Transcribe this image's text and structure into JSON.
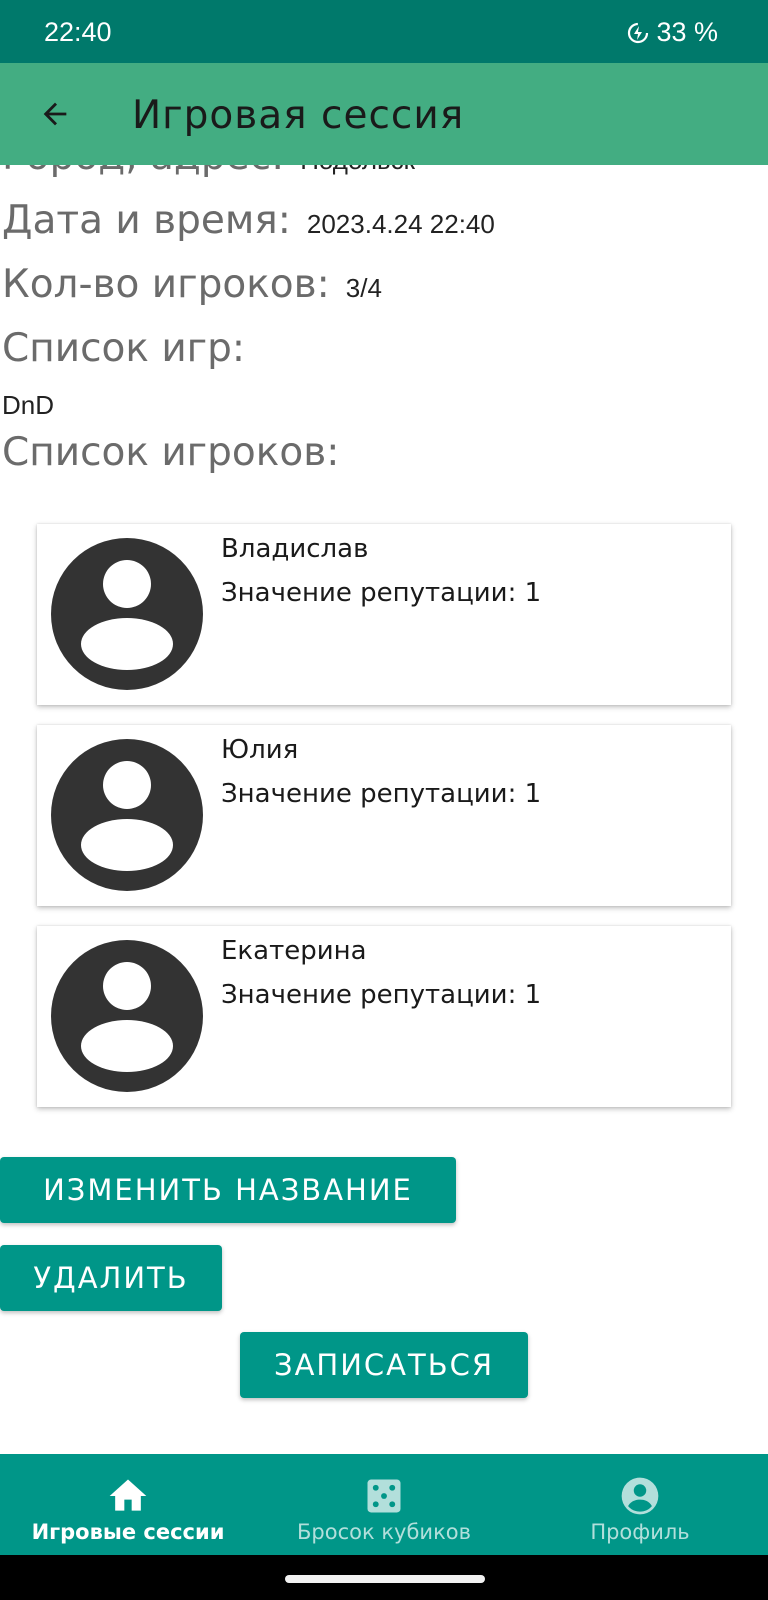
{
  "status_bar": {
    "time": "22:40",
    "battery": "33 %"
  },
  "app_bar": {
    "title": "Игровая сессия",
    "back_icon": "arrow-left-icon"
  },
  "info": {
    "city_label": "Город, адрес:",
    "city_value": "Подольск",
    "datetime_label": "Дата и время:",
    "datetime_value": "2023.4.24 22:40",
    "players_count_label": "Кол-во игроков:",
    "players_count_value": "3/4",
    "games_label": "Список игр:",
    "games_value": "DnD",
    "players_label": "Список игроков:"
  },
  "players": [
    {
      "name": "Владислав",
      "reputation": "Значение репутации: 1"
    },
    {
      "name": "Юлия",
      "reputation": "Значение репутации: 1"
    },
    {
      "name": "Екатерина",
      "reputation": "Значение репутации: 1"
    }
  ],
  "buttons": {
    "rename": "ИЗМЕНИТЬ НАЗВАНИЕ",
    "delete": "УДАЛИТЬ",
    "signup": "ЗАПИСАТЬСЯ"
  },
  "bottom_nav": [
    {
      "label": "Игровые сессии",
      "icon": "home-icon",
      "active": true
    },
    {
      "label": "Бросок кубиков",
      "icon": "dice-icon",
      "active": false
    },
    {
      "label": "Профиль",
      "icon": "account-circle-icon",
      "active": false
    }
  ],
  "colors": {
    "status_bar": "#00796b",
    "app_bar": "#43ad82",
    "accent": "#009688"
  }
}
